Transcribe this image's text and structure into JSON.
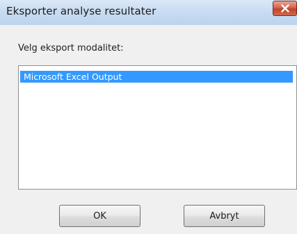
{
  "window": {
    "title": "Eksporter analyse resultater",
    "close_icon": "close-icon"
  },
  "dialog": {
    "prompt": "Velg eksport modalitet:",
    "options": [
      {
        "label": "Microsoft Excel Output",
        "selected": true
      }
    ],
    "ok_label": "OK",
    "cancel_label": "Avbryt"
  },
  "colors": {
    "selection": "#3399ff",
    "close_button": "#c0422a",
    "titlebar": "#c9dcf2"
  }
}
